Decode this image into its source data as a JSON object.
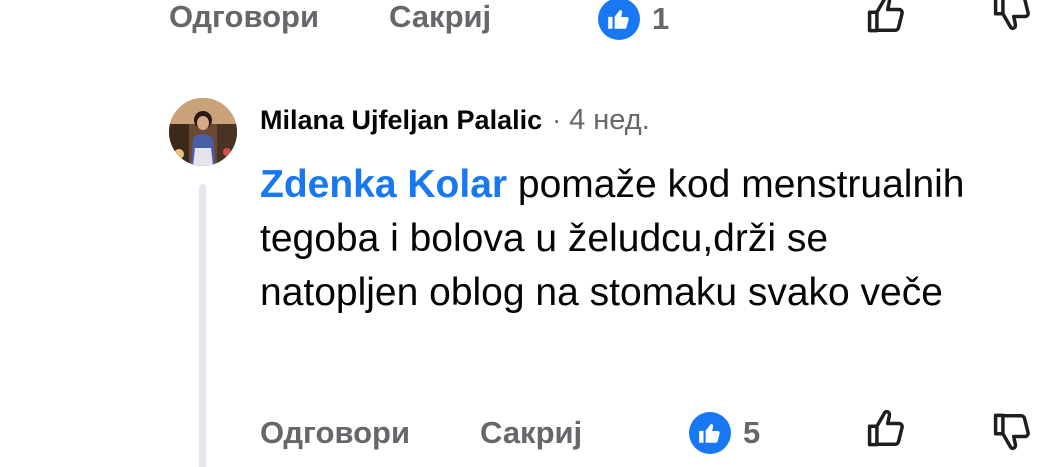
{
  "previous_comment": {
    "reply_label": "Одговори",
    "hide_label": "Сакриј",
    "reaction_count": "1",
    "reaction_icon": "like-icon"
  },
  "comment": {
    "author": "Milana Ujfeljan Palalic",
    "separator": "·",
    "time": "4 нед.",
    "mention": "Zdenka Kolar",
    "text": " pomaže kod menstrualnih tegoba i bolova u želudcu,drži se natopljen oblog na stomaku svako veče",
    "reply_label": "Одговори",
    "hide_label": "Сакриј",
    "reaction_count": "5",
    "reaction_icon": "like-icon"
  },
  "colors": {
    "accent": "#1877f2",
    "secondary_text": "#65676b",
    "thread_line": "#e4e6eb"
  }
}
